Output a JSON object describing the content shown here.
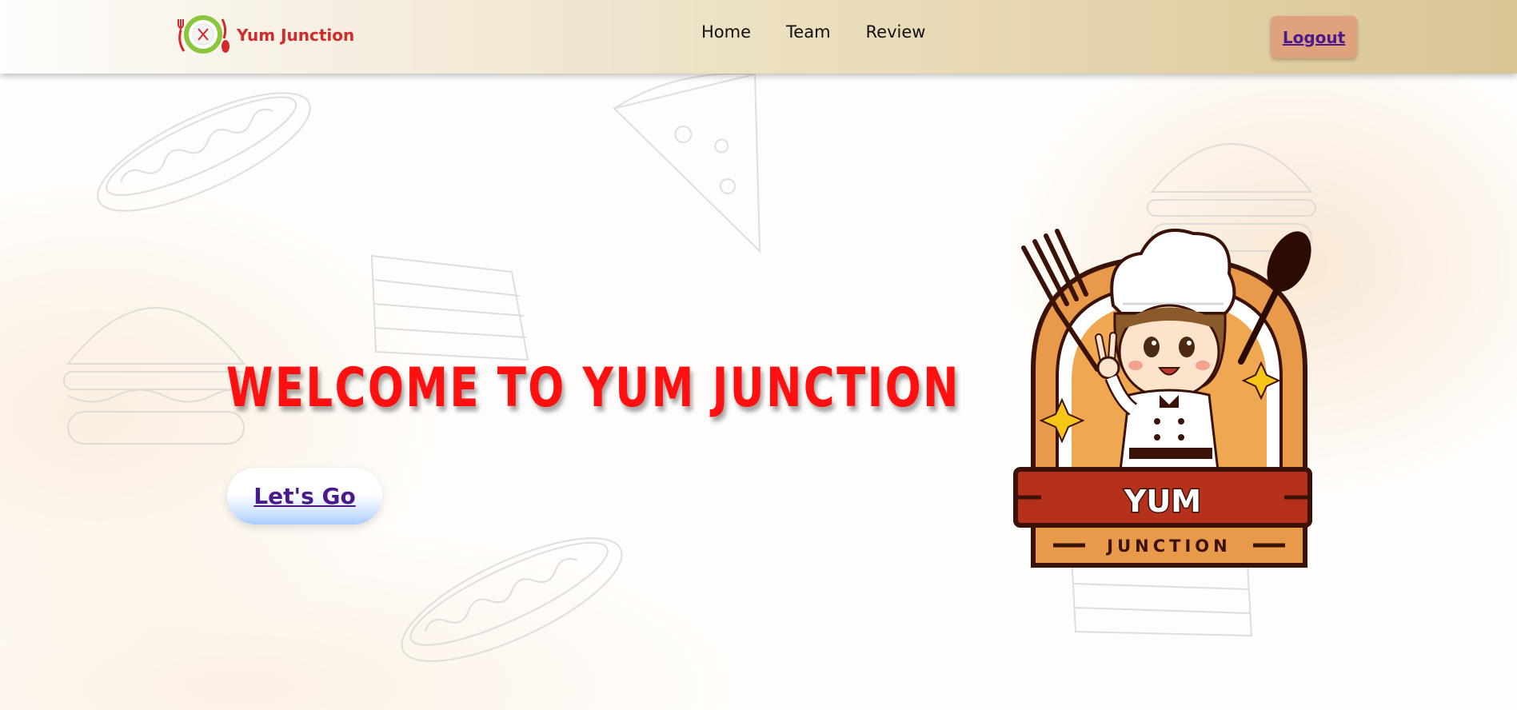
{
  "brand": {
    "name": "Yum Junction",
    "logo_icon": "plate-fork-spoon-logo-icon"
  },
  "nav": {
    "items": [
      {
        "label": "Home"
      },
      {
        "label": "Team"
      },
      {
        "label": "Review"
      }
    ],
    "logout_label": "Logout"
  },
  "hero": {
    "title": "WELCOME TO YUM JUNCTION",
    "cta_label": "Let's Go"
  },
  "mascot": {
    "icon": "chef-mascot-logo-icon",
    "banner_text": "YUM",
    "sub_text": "JUNCTION"
  },
  "colors": {
    "title_red": "#ff1010",
    "brand_red": "#d42a2a",
    "logout_bg": "#e0a27c",
    "link_purple": "#4a1a8c",
    "nav_gradient_end": "#d9c594"
  }
}
